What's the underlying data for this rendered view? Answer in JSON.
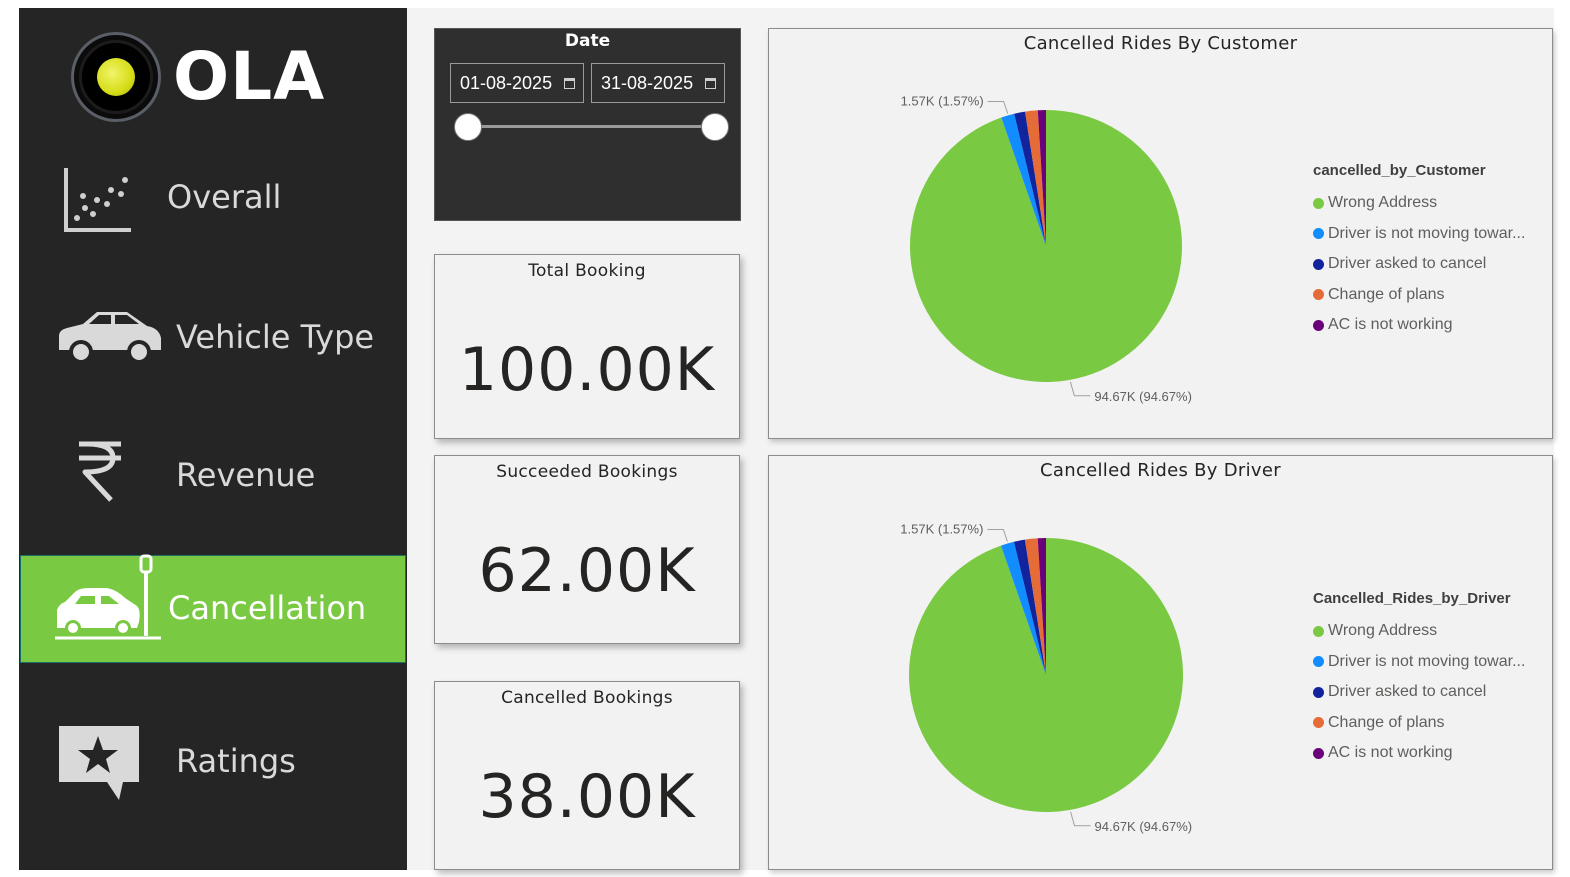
{
  "app": {
    "logo_text": "OLA"
  },
  "nav": {
    "overall": "Overall",
    "vehicle_type": "Vehicle Type",
    "revenue": "Revenue",
    "cancellation": "Cancellation",
    "ratings": "Ratings",
    "active": "Cancellation",
    "active_color": "#7ac943"
  },
  "date_slicer": {
    "title": "Date",
    "start": "01-08-2025",
    "end": "31-08-2025",
    "range_start_fraction": 0,
    "range_end_fraction": 1
  },
  "kpis": {
    "total_booking": {
      "title": "Total Booking",
      "value": "100.00K"
    },
    "succeeded_bookings": {
      "title": "Succeeded Bookings",
      "value": "62.00K"
    },
    "cancelled_bookings": {
      "title": "Cancelled Bookings",
      "value": "38.00K"
    }
  },
  "chart_data": [
    {
      "type": "pie",
      "title": "Cancelled Rides By Customer",
      "legend_title": "cancelled_by_Customer",
      "legend_position": "right",
      "labels": [
        "Wrong Address",
        "Driver is not moving towar...",
        "Driver asked to cancel",
        "Change of plans",
        "AC is not working"
      ],
      "values": [
        94.67,
        1.57,
        1.3,
        1.5,
        0.96
      ],
      "colors": [
        "#7ac943",
        "#118dff",
        "#12239e",
        "#e66c37",
        "#6b007b"
      ],
      "data_labels": {
        "top": "1.57K (1.57%)",
        "bottom": "94.67K (94.67%)"
      }
    },
    {
      "type": "pie",
      "title": "Cancelled Rides By Driver",
      "legend_title": "Cancelled_Rides_by_Driver",
      "legend_position": "right",
      "labels": [
        "Wrong Address",
        "Driver is not moving towar...",
        "Driver asked to cancel",
        "Change of plans",
        "AC is not working"
      ],
      "values": [
        94.67,
        1.57,
        1.3,
        1.5,
        0.96
      ],
      "colors": [
        "#7ac943",
        "#118dff",
        "#12239e",
        "#e66c37",
        "#6b007b"
      ],
      "data_labels": {
        "top": "1.57K (1.57%)",
        "bottom": "94.67K (94.67%)"
      }
    }
  ]
}
